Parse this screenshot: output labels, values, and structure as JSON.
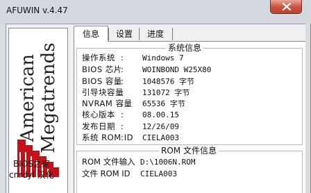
{
  "window": {
    "title": "AFUWIN v.4.47",
    "close_icon": "close-icon"
  },
  "tabs": [
    {
      "label": "信息",
      "active": true
    },
    {
      "label": "设置",
      "active": false
    },
    {
      "label": "进度",
      "active": false
    }
  ],
  "sidebar": {
    "logo_line1": "American",
    "logo_line2": "Megatrends",
    "logo_icon": "ami-logo-icon",
    "credit_line1": "BIOS之家",
    "credit_line2": "cnrdyl 汉化"
  },
  "system_info": {
    "title": "系统信息",
    "rows": [
      {
        "label": "操作系统",
        "value": "Windows 7"
      },
      {
        "label": "BIOS 芯片",
        "value": "WOINBOND W25X80"
      },
      {
        "label": "BIOS 容量",
        "value": "1048576 字节"
      },
      {
        "label": "引导块容量",
        "value": "131072 字节"
      },
      {
        "label": "NVRAM 容量",
        "value": "65536 字节"
      },
      {
        "label": "核心版本",
        "value": "08.00.15"
      },
      {
        "label": "发布日期",
        "value": "12/26/09"
      },
      {
        "label": "系统 ROM ID",
        "value": "CIELA003"
      }
    ]
  },
  "rom_info": {
    "title": "ROM 文件信息",
    "rows": [
      {
        "label": "ROM 文件输入",
        "value": "D:\\1006N.ROM"
      },
      {
        "label": "文件 ROM ID",
        "value": "CIELA003"
      }
    ]
  }
}
